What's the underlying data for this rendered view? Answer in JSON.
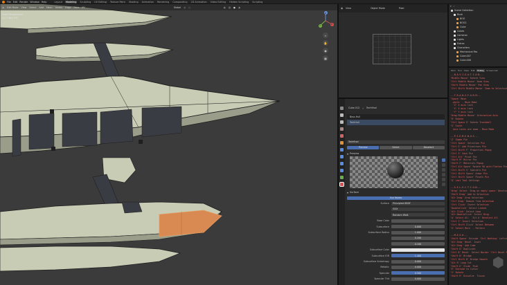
{
  "menubar": {
    "items": [
      "File",
      "Edit",
      "Render",
      "Window",
      "Help"
    ],
    "workspaces": [
      "Layout",
      "Modeling",
      "Sculpting",
      "UV Editing",
      "Texture Paint",
      "Shading",
      "Animation",
      "Rendering",
      "Compositing",
      "2D Animation",
      "Video Editing",
      "Hidden Scripting",
      "Scripting"
    ],
    "active_workspace": "Modeling"
  },
  "viewport": {
    "header": {
      "mode": "Edit Mode",
      "menus": [
        "View",
        "Select",
        "Add",
        "Mesh",
        "Vertex",
        "Edge",
        "Face",
        "UV"
      ],
      "orientation": "Global"
    },
    "info": {
      "view": "User Perspective",
      "object": "(1) Cube.012"
    },
    "colors": {
      "background": "#3b3b3b",
      "hull": "#c9ccb5",
      "hull_shadow": "#9a9d8a",
      "panel": "#3a3c44",
      "edge": "#1e1e1e",
      "selected_face": "#d98a52"
    }
  },
  "camera_view": {
    "header": {
      "menus": [
        "View"
      ],
      "mode": "Object Mode",
      "shading": "Pixel"
    }
  },
  "properties": {
    "object_name": "Cube.012",
    "material_name": "Techfinal",
    "slots": [
      "Boss Hull",
      "TechHull"
    ],
    "slot_material": "Techfinal",
    "preview_tabs": [
      "Preview",
      "Select",
      "Deselect"
    ],
    "sections": {
      "preview": "Preview",
      "surface": "Surface"
    },
    "use_nodes": "Use Nodes",
    "rows": [
      {
        "label": "Surface",
        "value": "Principled BSDF",
        "kind": "dark"
      },
      {
        "label": "",
        "value": "GGX",
        "kind": "dark"
      },
      {
        "label": "",
        "value": "Random Walk",
        "kind": "dark"
      },
      {
        "label": "Base Color",
        "value": "",
        "kind": "plain"
      },
      {
        "label": "Subsurface",
        "value": "0.000",
        "kind": "plain"
      },
      {
        "label": "Subsurface Radius",
        "value": "1.000",
        "kind": "plain"
      },
      {
        "label": "",
        "value": "0.200",
        "kind": "plain"
      },
      {
        "label": "",
        "value": "0.100",
        "kind": "plain"
      },
      {
        "label": "Subsurface Color",
        "value": "",
        "kind": "white"
      },
      {
        "label": "Subsurface IOR",
        "value": "1.400",
        "kind": "blue"
      },
      {
        "label": "Subsurface Anisotropy",
        "value": "0.000",
        "kind": "plain"
      },
      {
        "label": "Metallic",
        "value": "0.000",
        "kind": "plain"
      },
      {
        "label": "Specular",
        "value": "0.500",
        "kind": "blue"
      },
      {
        "label": "Specular Tint",
        "value": "0.000",
        "kind": "plain"
      }
    ]
  },
  "outliner": {
    "items": [
      {
        "name": "Scene Collection",
        "indent": 0,
        "color": "#d8d8d8"
      },
      {
        "name": "Bush",
        "indent": 1,
        "color": "#e6e6e6"
      },
      {
        "name": "BOO",
        "indent": 2,
        "color": "#f0a040"
      },
      {
        "name": "BOO2",
        "indent": 2,
        "color": "#f0a040"
      },
      {
        "name": "Cube",
        "indent": 2,
        "color": "#f0a040"
      },
      {
        "name": "Cubes",
        "indent": 1,
        "color": "#e6e6e6"
      },
      {
        "name": "Cameras",
        "indent": 1,
        "color": "#e6e6e6"
      },
      {
        "name": "Lights",
        "indent": 1,
        "color": "#e6e6e6"
      },
      {
        "name": "Extras",
        "indent": 1,
        "color": "#e6e6e6"
      },
      {
        "name": "Characters",
        "indent": 1,
        "color": "#e6e6e6"
      },
      {
        "name": "Mechanical Pas",
        "indent": 2,
        "color": "#f0a040"
      },
      {
        "name": "Cube.007",
        "indent": 2,
        "color": "#f0a040"
      },
      {
        "name": "Cube.008",
        "indent": 2,
        "color": "#f0a040"
      }
    ]
  },
  "sidebar": {
    "tabs": [
      "Item",
      "Tool",
      "View",
      "Edit",
      "Hotkey",
      "Screencast"
    ],
    "lines": [
      {
        "t": "---N-A-V-I-G-A-T-I-O-N---",
        "h": true
      },
      {
        "t": "'Middle Mouse' Rotate View"
      },
      {
        "t": "'Ctrl Middle Mouse' Zoom View"
      },
      {
        "t": "'Shift Middle Mouse' Pan View"
      },
      {
        "t": "'Ctrl Shift Middle Mouse' Zoom to Selection"
      },
      {
        "t": ""
      },
      {
        "t": "---T-R-A-N-S-F-O-R-M---",
        "h": true
      },
      {
        "t": "'Space' Move"
      },
      {
        "t": "  while  - Move Mode"
      },
      {
        "t": "  'Z' X axis lock"
      },
      {
        "t": "  'X' X axis lock"
      },
      {
        "t": "  'Y' Y axis lock"
      },
      {
        "t": "'Drag Middle Mouse' Interactive Axis"
      },
      {
        "t": "'R' Rotate"
      },
      {
        "t": "'Ctrl Space R' Rotate Trackball"
      },
      {
        "t": "'S' Scale"
      },
      {
        "t": "  Axis Locks are same - Move Mode"
      },
      {
        "t": ""
      },
      {
        "t": "---P-I-E-M-E-N-U-S---",
        "h": true
      },
      {
        "t": "'Z' Shade Pie"
      },
      {
        "t": "'Ctrl Space' Selection Pie"
      },
      {
        "t": "'Ctrl E' Add Primitives Pie"
      },
      {
        "t": "'Ctrl Shift F' Properties Popup"
      },
      {
        "t": "'Ctrl S' Save Pie"
      },
      {
        "t": "'Ctrl Alt' Pivot Pie"
      },
      {
        "t": "'Shift M' Mirror Pie"
      },
      {
        "t": "'Shift F' Materials Popup"
      },
      {
        "t": "'Ctrl Alt Space' Rotate 90 with Flatten Pie"
      },
      {
        "t": "'Ctrl Shift S' Specials Pie"
      },
      {
        "t": "'Ctrl Shift Space' Armor Pie"
      },
      {
        "t": "'Ctrl Shift Space' Pivots Pie"
      },
      {
        "t": "'Q' Last Tool Settings"
      },
      {
        "t": ""
      },
      {
        "t": "---S-E-L-E-C-T-I-O-N---",
        "h": true
      },
      {
        "t": "'Drag' Select 'Drag on empty space' Deselect"
      },
      {
        "t": "'Shift Drag' Add to Selection"
      },
      {
        "t": "'Alt Drag' Grow Selection"
      },
      {
        "t": "'Ctrl Drag' Remove from Selection"
      },
      {
        "t": "'Ctrl Click' Invert Selection"
      },
      {
        "t": "'DoubleClick' Select Linked"
      },
      {
        "t": "'Alt Click' Select Loop"
      },
      {
        "t": "'Alt DoubleClick' Select Ring"
      },
      {
        "t": "'A' Select All  'Alt A' Deselect All"
      },
      {
        "t": "'Ctrl I' Invert Selection"
      },
      {
        "t": "'Ctrl Shift Click' Select Between"
      },
      {
        "t": "'G' Select More  - Pattern"
      },
      {
        "t": ""
      },
      {
        "t": "---M-E-S-H---",
        "h": true
      },
      {
        "t": "'Shift Space' Extrude 'Ctrl Nothing' Leftright"
      },
      {
        "t": "'Alt Drag' Bevel  Inset"
      },
      {
        "t": "'Alt Drag' Add Cube"
      },
      {
        "t": "'Shift D' Duplicate"
      },
      {
        "t": "'Ctrl B' Bevel  Select Border 'Ctrl Bevel Points'"
      },
      {
        "t": "'Shift B' Bridge"
      },
      {
        "t": "'Ctrl Shift B' Bridge Smooth"
      },
      {
        "t": "'Alt R' Loop Cut"
      },
      {
        "t": "'Shift E' Slide  Push"
      },
      {
        "t": "'E' Extrude to Cursor"
      },
      {
        "t": "'V' Rotate"
      },
      {
        "t": "'Shift R' Dissolve  Tissue"
      }
    ]
  }
}
